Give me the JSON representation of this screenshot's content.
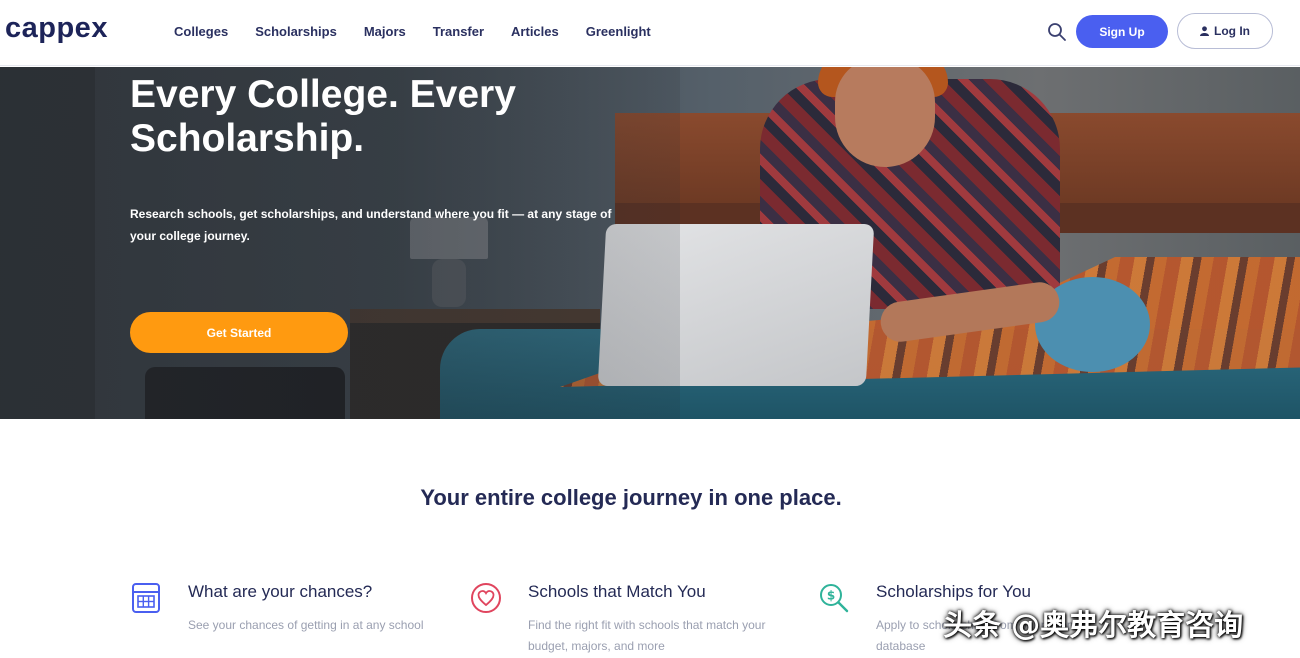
{
  "header": {
    "logo": "cappex",
    "nav": [
      "Colleges",
      "Scholarships",
      "Majors",
      "Transfer",
      "Articles",
      "Greenlight"
    ],
    "search_icon": "search-icon",
    "signup_label": "Sign Up",
    "login_label": "Log In",
    "login_icon": "user-icon"
  },
  "hero": {
    "title": "Every College. Every Scholarship.",
    "subtitle": "Research schools, get scholarships, and understand where you fit — at any stage of your college journey.",
    "cta_label": "Get Started"
  },
  "section": {
    "title": "Your entire college journey in one place.",
    "features": [
      {
        "icon": "calculator-icon",
        "title": "What are your chances?",
        "desc": "See your chances of getting in at any school"
      },
      {
        "icon": "heart-icon",
        "title": "Schools that Match You",
        "desc": "Find the right fit with schools that match your budget, majors, and more"
      },
      {
        "icon": "money-search-icon",
        "title": "Scholarships for You",
        "desc": "Apply to scholarships from our national database"
      }
    ]
  },
  "watermark": "头条 @奥弗尔教育咨询",
  "colors": {
    "brand": "#1d2459",
    "primary": "#4a5ff0",
    "cta": "#ff9a10"
  }
}
